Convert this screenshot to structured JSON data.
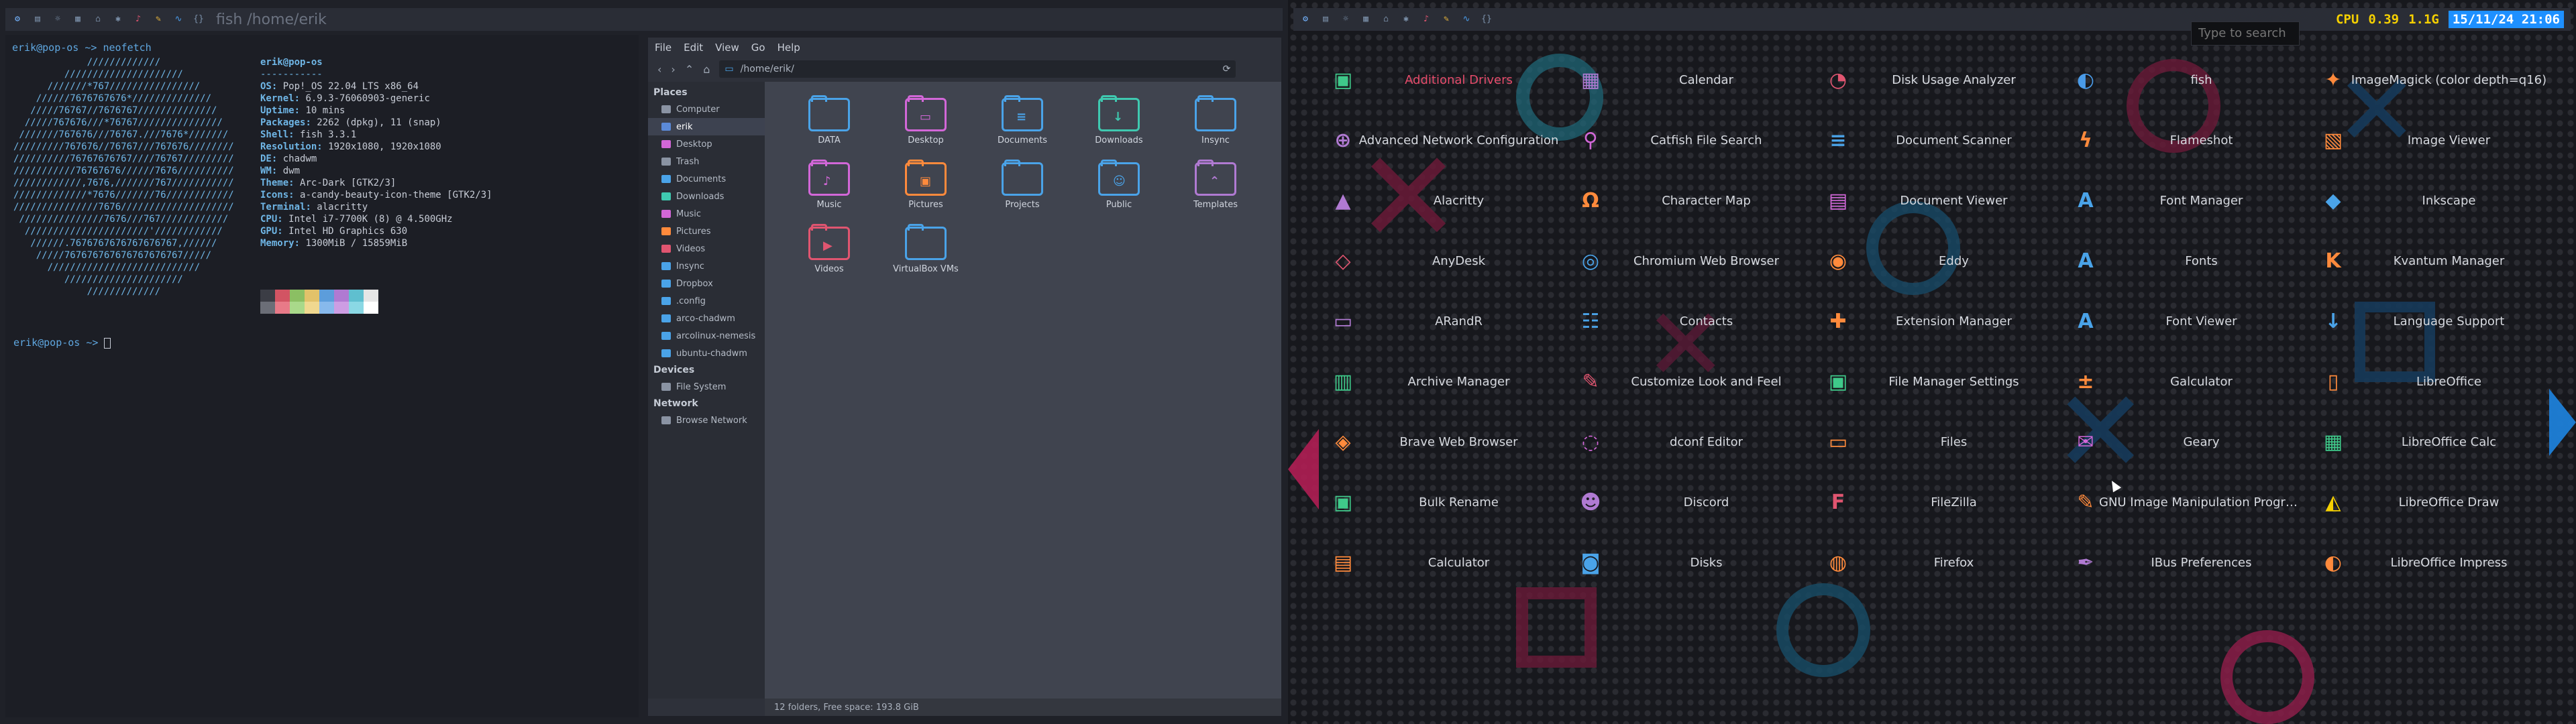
{
  "left_bar": {
    "tags": [
      "⚙",
      "▤",
      "☼",
      "▦",
      "⌂",
      "✱",
      "♪",
      "✎",
      "∿",
      "{}"
    ],
    "window_title": "fish /home/erik"
  },
  "right_bar": {
    "tags": [
      "⚙",
      "▤",
      "☼",
      "▦",
      "⌂",
      "✱",
      "♪",
      "✎",
      "∿",
      "{}"
    ],
    "cpu_label": "CPU",
    "cpu_value": "0.39",
    "mem": "1.1G",
    "datetime": "15/11/24 21:06"
  },
  "terminal": {
    "prompt_line": "erik@pop-os ~> ",
    "command": "neofetch",
    "ascii_art": "             /////////////\n         /////////////////////\n      ///////*767////////////////\n    //////7676767676*//////////////\n   /////76767//7676767//////////////\n  /////767676///*76767///////////////\n ///////767676///76767.///7676*///////\n/////////767676//76767///767676////////\n//////////76767676767////76767/////////\n///////////76767676//////7676//////////\n////////////,7676,///////767///////////\n/////////////*7676///////76////////////\n///////////////7676////////////////////\n ///////////////7676///767////////////\n  //////////////////////'////////////\n   //////.7676767676767676767,//////\n    /////767676767676767676767/////\n      ///////////////////////////\n         /////////////////////\n             /////////////",
    "fetch_user": "erik@pop-os",
    "fetch_sep": "-----------",
    "fetch": [
      {
        "k": "OS",
        "v": "Pop!_OS 22.04 LTS x86_64"
      },
      {
        "k": "Kernel",
        "v": "6.9.3-76060903-generic"
      },
      {
        "k": "Uptime",
        "v": "10 mins"
      },
      {
        "k": "Packages",
        "v": "2262 (dpkg), 11 (snap)"
      },
      {
        "k": "Shell",
        "v": "fish 3.3.1"
      },
      {
        "k": "Resolution",
        "v": "1920x1080, 1920x1080"
      },
      {
        "k": "DE",
        "v": "chadwm"
      },
      {
        "k": "WM",
        "v": "dwm"
      },
      {
        "k": "Theme",
        "v": "Arc-Dark [GTK2/3]"
      },
      {
        "k": "Icons",
        "v": "a-candy-beauty-icon-theme [GTK2/3]"
      },
      {
        "k": "Terminal",
        "v": "alacritty"
      },
      {
        "k": "CPU",
        "v": "Intel i7-7700K (8) @ 4.500GHz"
      },
      {
        "k": "GPU",
        "v": "Intel HD Graphics 630"
      },
      {
        "k": "Memory",
        "v": "1300MiB / 15859MiB"
      }
    ],
    "swatch_colors": [
      "#3b3d45",
      "#d25463",
      "#8bbf63",
      "#e2c26a",
      "#5c9ddb",
      "#b07ad2",
      "#5fbfcf",
      "#e6e6e6",
      "#6b6e77",
      "#e87a88",
      "#a9d98a",
      "#f0d88f",
      "#87b9ec",
      "#cd9de3",
      "#8ad8e4",
      "#ffffff"
    ],
    "prompt_line2": "erik@pop-os ~> "
  },
  "file_manager": {
    "menu": [
      "File",
      "Edit",
      "View",
      "Go",
      "Help"
    ],
    "path": "/home/erik/",
    "sections": [
      {
        "title": "Places",
        "items": [
          {
            "label": "Computer",
            "color": "#8a93a3"
          },
          {
            "label": "erik",
            "color": "#5b8ad8",
            "selected": true
          },
          {
            "label": "Desktop",
            "color": "#d267d8"
          },
          {
            "label": "Trash",
            "color": "#8a93a3"
          },
          {
            "label": "Documents",
            "color": "#4aa3e8"
          },
          {
            "label": "Downloads",
            "color": "#3fc9b0"
          },
          {
            "label": "Music",
            "color": "#d267d8"
          },
          {
            "label": "Pictures",
            "color": "#ff8a3c"
          },
          {
            "label": "Videos",
            "color": "#e05570"
          },
          {
            "label": "Insync",
            "color": "#4aa3e8"
          },
          {
            "label": "Dropbox",
            "color": "#4aa3e8"
          },
          {
            "label": ".config",
            "color": "#4aa3e8"
          },
          {
            "label": "arco-chadwm",
            "color": "#4aa3e8"
          },
          {
            "label": "arcolinux-nemesis",
            "color": "#4aa3e8"
          },
          {
            "label": "ubuntu-chadwm",
            "color": "#4aa3e8"
          }
        ]
      },
      {
        "title": "Devices",
        "items": [
          {
            "label": "File System",
            "color": "#8a93a3"
          }
        ]
      },
      {
        "title": "Network",
        "items": [
          {
            "label": "Browse Network",
            "color": "#8a93a3"
          }
        ]
      }
    ],
    "folders": [
      {
        "label": "DATA",
        "color": "#4aa3e8",
        "glyph": ""
      },
      {
        "label": "Desktop",
        "color": "#d267d8",
        "glyph": "▭"
      },
      {
        "label": "Documents",
        "color": "#4aa3e8",
        "glyph": "≡"
      },
      {
        "label": "Downloads",
        "color": "#3fc9b0",
        "glyph": "↓"
      },
      {
        "label": "Insync",
        "color": "#4aa3e8",
        "glyph": ""
      },
      {
        "label": "Music",
        "color": "#d267d8",
        "glyph": "♪"
      },
      {
        "label": "Pictures",
        "color": "#ff8a3c",
        "glyph": "▣"
      },
      {
        "label": "Projects",
        "color": "#4aa3e8",
        "glyph": ""
      },
      {
        "label": "Public",
        "color": "#4aa3e8",
        "glyph": "☺"
      },
      {
        "label": "Templates",
        "color": "#b07ad2",
        "glyph": "⌃"
      },
      {
        "label": "Videos",
        "color": "#e05570",
        "glyph": "▶"
      },
      {
        "label": "VirtualBox VMs",
        "color": "#4aa3e8",
        "glyph": ""
      }
    ],
    "status": "12 folders, Free space: 193.8 GiB"
  },
  "launcher": {
    "search_placeholder": "Type to search",
    "apps": [
      {
        "label": "Additional Drivers",
        "icon": "drivers-icon",
        "glyph": "▣",
        "color": "#3fc98a",
        "highlight": true
      },
      {
        "label": "Calendar",
        "icon": "calendar-icon",
        "glyph": "▦",
        "color": "#b07ad2"
      },
      {
        "label": "Disk Usage Analyzer",
        "icon": "disk-usage-icon",
        "glyph": "◔",
        "color": "#e05570"
      },
      {
        "label": "fish",
        "icon": "fish-icon",
        "glyph": "◐",
        "color": "#4a9be8"
      },
      {
        "label": "ImageMagick (color depth=q16)",
        "icon": "imagemagick-icon",
        "glyph": "✦",
        "color": "#ff8a3c"
      },
      {
        "label": "Advanced Network Configuration",
        "icon": "network-icon",
        "glyph": "⊕",
        "color": "#b07ad2"
      },
      {
        "label": "Catfish File Search",
        "icon": "search-icon",
        "glyph": "⚲",
        "color": "#d267d8"
      },
      {
        "label": "Document Scanner",
        "icon": "scanner-icon",
        "glyph": "≡",
        "color": "#4aa3e8"
      },
      {
        "label": "Flameshot",
        "icon": "flameshot-icon",
        "glyph": "ϟ",
        "color": "#ff8a3c"
      },
      {
        "label": "Image Viewer",
        "icon": "image-viewer-icon",
        "glyph": "▧",
        "color": "#ff8a3c"
      },
      {
        "label": "Alacritty",
        "icon": "alacritty-icon",
        "glyph": "▲",
        "color": "#b07ad2"
      },
      {
        "label": "Character Map",
        "icon": "character-map-icon",
        "glyph": "Ω",
        "color": "#ff8a3c"
      },
      {
        "label": "Document Viewer",
        "icon": "document-viewer-icon",
        "glyph": "▤",
        "color": "#d267d8"
      },
      {
        "label": "Font Manager",
        "icon": "font-manager-icon",
        "glyph": "A",
        "color": "#4aa3e8"
      },
      {
        "label": "Inkscape",
        "icon": "inkscape-icon",
        "glyph": "◆",
        "color": "#4aa3e8"
      },
      {
        "label": "AnyDesk",
        "icon": "anydesk-icon",
        "glyph": "◇",
        "color": "#e05570"
      },
      {
        "label": "Chromium Web Browser",
        "icon": "chromium-icon",
        "glyph": "◎",
        "color": "#4aa3e8"
      },
      {
        "label": "Eddy",
        "icon": "eddy-icon",
        "glyph": "◉",
        "color": "#ff8a3c"
      },
      {
        "label": "Fonts",
        "icon": "fonts-icon",
        "glyph": "A",
        "color": "#4aa3e8"
      },
      {
        "label": "Kvantum Manager",
        "icon": "kvantum-icon",
        "glyph": "K",
        "color": "#ff8a3c"
      },
      {
        "label": "ARandR",
        "icon": "arandr-icon",
        "glyph": "▭",
        "color": "#b07ad2"
      },
      {
        "label": "Contacts",
        "icon": "contacts-icon",
        "glyph": "☷",
        "color": "#4aa3e8"
      },
      {
        "label": "Extension Manager",
        "icon": "extension-icon",
        "glyph": "✚",
        "color": "#ff8a3c"
      },
      {
        "label": "Font Viewer",
        "icon": "font-viewer-icon",
        "glyph": "A",
        "color": "#4aa3e8"
      },
      {
        "label": "Language Support",
        "icon": "language-icon",
        "glyph": "↓",
        "color": "#4aa3e8"
      },
      {
        "label": "Archive Manager",
        "icon": "archive-icon",
        "glyph": "▥",
        "color": "#3fc98a"
      },
      {
        "label": "Customize Look and Feel",
        "icon": "brush-icon",
        "glyph": "✎",
        "color": "#e05570"
      },
      {
        "label": "File Manager Settings",
        "icon": "file-manager-settings-icon",
        "glyph": "▣",
        "color": "#3fc98a"
      },
      {
        "label": "Galculator",
        "icon": "galculator-icon",
        "glyph": "±",
        "color": "#ff8a3c"
      },
      {
        "label": "LibreOffice",
        "icon": "libreoffice-icon",
        "glyph": "▯",
        "color": "#ff8a3c"
      },
      {
        "label": "Brave Web Browser",
        "icon": "brave-icon",
        "glyph": "◈",
        "color": "#ff8a3c"
      },
      {
        "label": "dconf Editor",
        "icon": "dconf-icon",
        "glyph": "◌",
        "color": "#d267d8"
      },
      {
        "label": "Files",
        "icon": "files-icon",
        "glyph": "▭",
        "color": "#ff8a3c"
      },
      {
        "label": "Geary",
        "icon": "geary-icon",
        "glyph": "✉",
        "color": "#d267d8"
      },
      {
        "label": "LibreOffice Calc",
        "icon": "calc-icon",
        "glyph": "▦",
        "color": "#3fc98a"
      },
      {
        "label": "Bulk Rename",
        "icon": "bulk-rename-icon",
        "glyph": "▣",
        "color": "#3fc98a"
      },
      {
        "label": "Discord",
        "icon": "discord-icon",
        "glyph": "☻",
        "color": "#b07ad2"
      },
      {
        "label": "FileZilla",
        "icon": "filezilla-icon",
        "glyph": "F",
        "color": "#e05570"
      },
      {
        "label": "GNU Image Manipulation Program",
        "icon": "gimp-icon",
        "glyph": "✎",
        "color": "#ff8a3c"
      },
      {
        "label": "LibreOffice Draw",
        "icon": "draw-icon",
        "glyph": "◭",
        "color": "#f5d000"
      },
      {
        "label": "Calculator",
        "icon": "calculator-icon",
        "glyph": "▤",
        "color": "#ff8a3c"
      },
      {
        "label": "Disks",
        "icon": "disks-icon",
        "glyph": "◙",
        "color": "#4aa3e8"
      },
      {
        "label": "Firefox",
        "icon": "firefox-icon",
        "glyph": "◍",
        "color": "#ff8a3c"
      },
      {
        "label": "IBus Preferences",
        "icon": "ibus-icon",
        "glyph": "✒",
        "color": "#b07ad2"
      },
      {
        "label": "LibreOffice Impress",
        "icon": "impress-icon",
        "glyph": "◐",
        "color": "#ff8a3c"
      }
    ]
  }
}
